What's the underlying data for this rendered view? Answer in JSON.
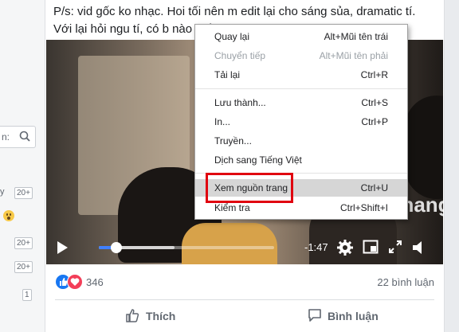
{
  "caption": "P/s: vid gốc ko nhạc. Hoi tối nên m edit lại cho sáng sủa, dramatic tí. Với lại hỏi ngu tí, có b nào biết cách",
  "sidebar": {
    "search_text": "n:",
    "rows": [
      {
        "label": "y",
        "badge": "20+"
      },
      {
        "label": "",
        "badge": "20+"
      },
      {
        "label": "",
        "badge": "20+"
      },
      {
        "label": "",
        "badge": "1"
      }
    ]
  },
  "video": {
    "time": "-1:47",
    "progress": 0.1,
    "buffered": 0.43
  },
  "context_menu": {
    "items": [
      {
        "label": "Quay lại",
        "shortcut": "Alt+Mũi tên trái",
        "disabled": false
      },
      {
        "label": "Chuyển tiếp",
        "shortcut": "Alt+Mũi tên phải",
        "disabled": true
      },
      {
        "label": "Tải lại",
        "shortcut": "Ctrl+R",
        "disabled": false
      },
      {
        "label": "Lưu thành...",
        "shortcut": "Ctrl+S",
        "disabled": false
      },
      {
        "label": "In...",
        "shortcut": "Ctrl+P",
        "disabled": false
      },
      {
        "label": "Truyền...",
        "shortcut": "",
        "disabled": false
      },
      {
        "label": "Dịch sang Tiếng Việt",
        "shortcut": "",
        "disabled": false
      },
      {
        "label": "Xem nguồn trang",
        "shortcut": "Ctrl+U",
        "disabled": false,
        "highlighted": true
      },
      {
        "label": "Kiểm tra",
        "shortcut": "Ctrl+Shift+I",
        "disabled": false
      }
    ]
  },
  "watermark": "uantrimang",
  "reactions": {
    "count": "346",
    "comments": "22 bình luận",
    "like_color": "#1877f2",
    "love_color": "#f33e58"
  },
  "actions": {
    "like_label": "Thích",
    "comment_label": "Bình luận"
  },
  "icons": {
    "search": "search-icon",
    "settings": "gear-icon",
    "pip": "picture-in-picture-icon",
    "fullscreen": "fullscreen-icon",
    "volume": "volume-icon",
    "play": "play-icon"
  },
  "colors": {
    "highlight_box": "#e0000f",
    "progress": "#4080ff"
  }
}
